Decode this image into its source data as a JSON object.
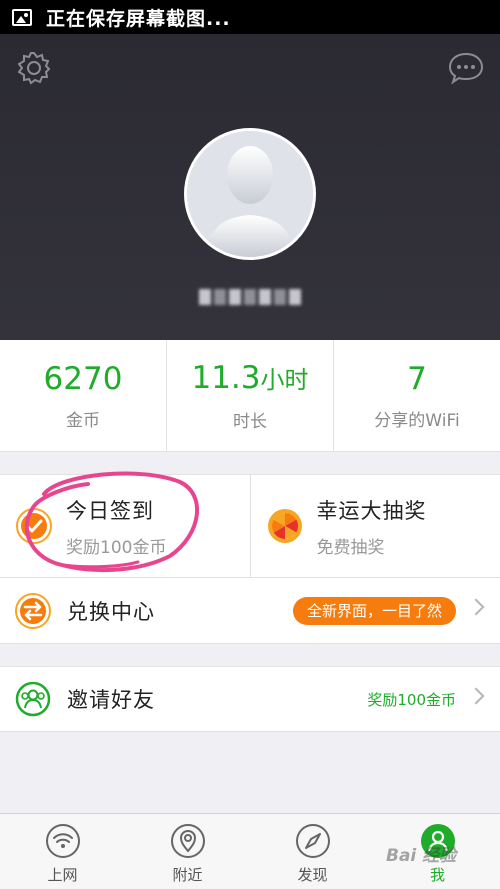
{
  "status_bar": {
    "text": "正在保存屏幕截图..."
  },
  "header": {
    "username": ""
  },
  "stats": [
    {
      "value": "6270",
      "unit": "",
      "label": "金币"
    },
    {
      "value": "11.3",
      "unit": "小时",
      "label": "时长"
    },
    {
      "value": "7",
      "unit": "",
      "label": "分享的WiFi"
    }
  ],
  "checkin": {
    "title": "今日签到",
    "subtitle": "奖励100金币"
  },
  "lottery": {
    "title": "幸运大抽奖",
    "subtitle": "免费抽奖"
  },
  "exchange": {
    "title": "兑换中心",
    "badge": "全新界面，一目了然"
  },
  "invite": {
    "title": "邀请好友",
    "reward": "奖励100金币"
  },
  "tabs": [
    {
      "label": "上网",
      "icon": "wifi-icon"
    },
    {
      "label": "附近",
      "icon": "location-pin-icon"
    },
    {
      "label": "发现",
      "icon": "compass-icon"
    },
    {
      "label": "我",
      "icon": "user-icon",
      "active": true
    }
  ],
  "watermark": "Bai 经验",
  "colors": {
    "accent_green": "#1fac2b",
    "orange": "#f77c0e",
    "header_bg": "#2b2a33",
    "annotation_pink": "#e8458f"
  }
}
